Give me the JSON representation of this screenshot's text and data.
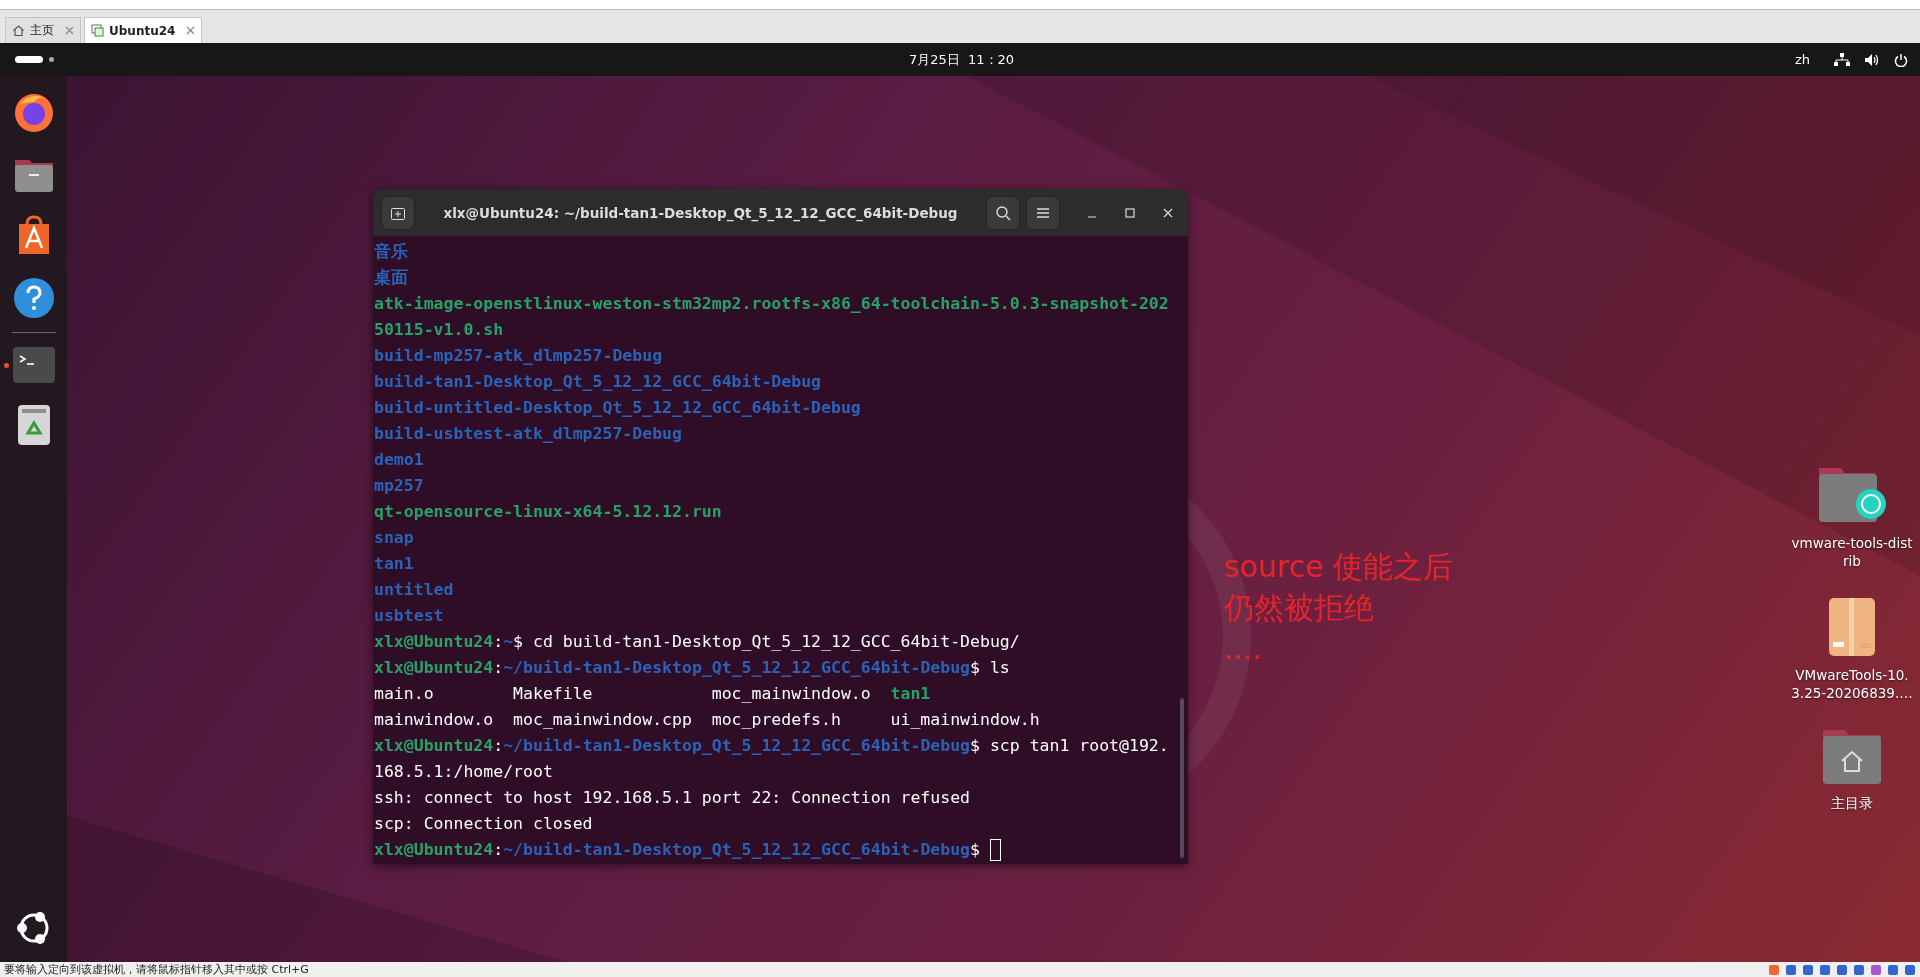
{
  "vm_tabs": [
    {
      "label": "主页",
      "kind": "home",
      "selected": false
    },
    {
      "label": "Ubuntu24",
      "kind": "vm",
      "selected": true
    }
  ],
  "top_bar": {
    "clock": "7月25日  11：20",
    "input_method": "zh"
  },
  "dock": {
    "items": [
      {
        "kind": "browser",
        "running": false
      },
      {
        "kind": "files",
        "running": false
      },
      {
        "kind": "store",
        "running": false
      },
      {
        "kind": "help",
        "running": false
      },
      {
        "kind": "separator"
      },
      {
        "kind": "terminal",
        "running": true
      },
      {
        "kind": "trash",
        "running": false
      }
    ]
  },
  "terminal": {
    "title": "xlx@Ubuntu24: ~/build-tan1-Desktop_Qt_5_12_12_GCC_64bit-Debug",
    "cursor": true,
    "lines": [
      [
        {
          "text": "音乐",
          "kind": "dir"
        }
      ],
      [
        {
          "text": "桌面",
          "kind": "dir"
        }
      ],
      [
        {
          "text": "atk-image-openstlinux-weston-stm32mp2.rootfs-x86_64-toolchain-5.0.3-snapshot-202",
          "kind": "exec"
        }
      ],
      [
        {
          "text": "50115-v1.0.sh",
          "kind": "exec"
        }
      ],
      [
        {
          "text": "build-mp257-atk_dlmp257-Debug",
          "kind": "dir"
        }
      ],
      [
        {
          "text": "build-tan1-Desktop_Qt_5_12_12_GCC_64bit-Debug",
          "kind": "dir"
        }
      ],
      [
        {
          "text": "build-untitled-Desktop_Qt_5_12_12_GCC_64bit-Debug",
          "kind": "dir"
        }
      ],
      [
        {
          "text": "build-usbtest-atk_dlmp257-Debug",
          "kind": "dir"
        }
      ],
      [
        {
          "text": "demo1",
          "kind": "dir"
        }
      ],
      [
        {
          "text": "mp257",
          "kind": "dir"
        }
      ],
      [
        {
          "text": "qt-opensource-linux-x64-5.12.12.run",
          "kind": "exec"
        }
      ],
      [
        {
          "text": "snap",
          "kind": "dir"
        }
      ],
      [
        {
          "text": "tan1",
          "kind": "dir"
        }
      ],
      [
        {
          "text": "untitled",
          "kind": "dir"
        }
      ],
      [
        {
          "text": "usbtest",
          "kind": "dir"
        }
      ],
      [
        {
          "text": "xlx@Ubuntu24",
          "kind": "user"
        },
        {
          "text": ":",
          "kind": "plain"
        },
        {
          "text": "~",
          "kind": "path"
        },
        {
          "text": "$ cd build-tan1-Desktop_Qt_5_12_12_GCC_64bit-Debug/",
          "kind": "plain"
        }
      ],
      [
        {
          "text": "xlx@Ubuntu24",
          "kind": "user"
        },
        {
          "text": ":",
          "kind": "plain"
        },
        {
          "text": "~/build-tan1-Desktop_Qt_5_12_12_GCC_64bit-Debug",
          "kind": "path"
        },
        {
          "text": "$ ls",
          "kind": "plain"
        }
      ],
      [
        {
          "text": "main.o        Makefile            moc_mainwindow.o  ",
          "kind": "plain"
        },
        {
          "text": "tan1",
          "kind": "exec"
        }
      ],
      [
        {
          "text": "mainwindow.o  moc_mainwindow.cpp  moc_predefs.h     ui_mainwindow.h",
          "kind": "plain"
        }
      ],
      [
        {
          "text": "xlx@Ubuntu24",
          "kind": "user"
        },
        {
          "text": ":",
          "kind": "plain"
        },
        {
          "text": "~/build-tan1-Desktop_Qt_5_12_12_GCC_64bit-Debug",
          "kind": "path"
        },
        {
          "text": "$ scp tan1 root@192.",
          "kind": "plain"
        }
      ],
      [
        {
          "text": "168.5.1:/home/root",
          "kind": "plain"
        }
      ],
      [
        {
          "text": "ssh: connect to host 192.168.5.1 port 22: Connection refused",
          "kind": "plain"
        }
      ],
      [
        {
          "text": "scp: Connection closed",
          "kind": "plain"
        }
      ],
      [
        {
          "text": "xlx@Ubuntu24",
          "kind": "user"
        },
        {
          "text": ":",
          "kind": "plain"
        },
        {
          "text": "~/build-tan1-Desktop_Qt_5_12_12_GCC_64bit-Debug",
          "kind": "path"
        },
        {
          "text": "$ ",
          "kind": "plain"
        }
      ]
    ]
  },
  "annotation": {
    "lines": [
      "source 使能之后",
      "仍然被拒绝",
      "...."
    ]
  },
  "desktop_icons": [
    {
      "label": "vmware-tools-distrib",
      "kind": "badged-folder"
    },
    {
      "label": "VMwareTools-10.3.25-20206839.…",
      "kind": "package"
    },
    {
      "label": "主目录",
      "kind": "home-folder"
    }
  ],
  "status_bar": {
    "message": "要将输入定向到该虚拟机，请将鼠标指针移入其中或按 Ctrl+G"
  }
}
